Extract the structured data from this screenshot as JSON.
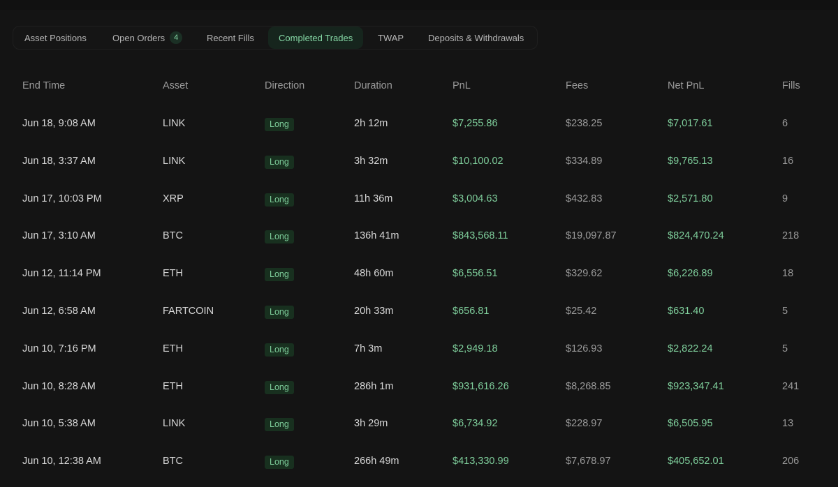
{
  "tabs": [
    {
      "label": "Asset Positions"
    },
    {
      "label": "Open Orders",
      "badge": "4"
    },
    {
      "label": "Recent Fills"
    },
    {
      "label": "Completed Trades",
      "active": true
    },
    {
      "label": "TWAP"
    },
    {
      "label": "Deposits & Withdrawals"
    }
  ],
  "table": {
    "headers": {
      "end_time": "End Time",
      "asset": "Asset",
      "direction": "Direction",
      "duration": "Duration",
      "pnl": "PnL",
      "fees": "Fees",
      "net_pnl": "Net PnL",
      "fills": "Fills"
    },
    "rows": [
      {
        "end_time": "Jun 18, 9:08 AM",
        "asset": "LINK",
        "direction": "Long",
        "duration": "2h 12m",
        "pnl": "$7,255.86",
        "fees": "$238.25",
        "net_pnl": "$7,017.61",
        "fills": "6"
      },
      {
        "end_time": "Jun 18, 3:37 AM",
        "asset": "LINK",
        "direction": "Long",
        "duration": "3h 32m",
        "pnl": "$10,100.02",
        "fees": "$334.89",
        "net_pnl": "$9,765.13",
        "fills": "16"
      },
      {
        "end_time": "Jun 17, 10:03 PM",
        "asset": "XRP",
        "direction": "Long",
        "duration": "11h 36m",
        "pnl": "$3,004.63",
        "fees": "$432.83",
        "net_pnl": "$2,571.80",
        "fills": "9"
      },
      {
        "end_time": "Jun 17, 3:10 AM",
        "asset": "BTC",
        "direction": "Long",
        "duration": "136h 41m",
        "pnl": "$843,568.11",
        "fees": "$19,097.87",
        "net_pnl": "$824,470.24",
        "fills": "218"
      },
      {
        "end_time": "Jun 12, 11:14 PM",
        "asset": "ETH",
        "direction": "Long",
        "duration": "48h 60m",
        "pnl": "$6,556.51",
        "fees": "$329.62",
        "net_pnl": "$6,226.89",
        "fills": "18"
      },
      {
        "end_time": "Jun 12, 6:58 AM",
        "asset": "FARTCOIN",
        "direction": "Long",
        "duration": "20h 33m",
        "pnl": "$656.81",
        "fees": "$25.42",
        "net_pnl": "$631.40",
        "fills": "5"
      },
      {
        "end_time": "Jun 10, 7:16 PM",
        "asset": "ETH",
        "direction": "Long",
        "duration": "7h 3m",
        "pnl": "$2,949.18",
        "fees": "$126.93",
        "net_pnl": "$2,822.24",
        "fills": "5"
      },
      {
        "end_time": "Jun 10, 8:28 AM",
        "asset": "ETH",
        "direction": "Long",
        "duration": "286h 1m",
        "pnl": "$931,616.26",
        "fees": "$8,268.85",
        "net_pnl": "$923,347.41",
        "fills": "241"
      },
      {
        "end_time": "Jun 10, 5:38 AM",
        "asset": "LINK",
        "direction": "Long",
        "duration": "3h 29m",
        "pnl": "$6,734.92",
        "fees": "$228.97",
        "net_pnl": "$6,505.95",
        "fills": "13"
      },
      {
        "end_time": "Jun 10, 12:38 AM",
        "asset": "BTC",
        "direction": "Long",
        "duration": "266h 49m",
        "pnl": "$413,330.99",
        "fees": "$7,678.97",
        "net_pnl": "$405,652.01",
        "fills": "206"
      }
    ]
  },
  "colors": {
    "background": "#141414",
    "accent_green": "#7fcf9c",
    "pill_bg": "#18301f",
    "text_muted": "#9a9a9a"
  }
}
